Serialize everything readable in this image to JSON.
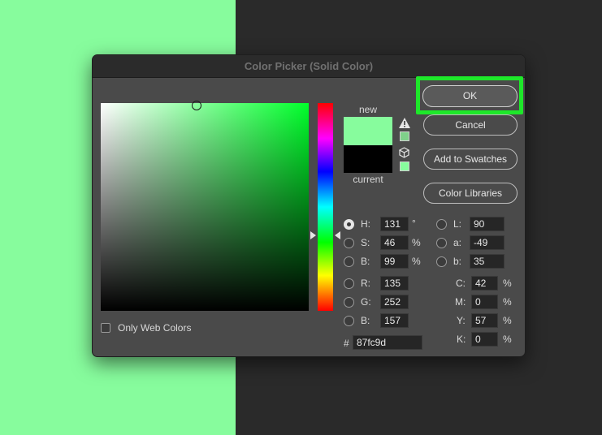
{
  "dialog": {
    "title": "Color Picker (Solid Color)"
  },
  "colors": {
    "selected": "#87fc9d",
    "current": "#000000",
    "hue_pure": "#00ff2b",
    "ok_highlight": "#1ee82a"
  },
  "swatches": {
    "new_label": "new",
    "current_label": "current"
  },
  "icons": {
    "gamut_warning": "warning-triangle-icon",
    "web_safe": "cube-icon"
  },
  "buttons": {
    "ok": "OK",
    "cancel": "Cancel",
    "add_to_swatches": "Add to Swatches",
    "color_libraries": "Color Libraries"
  },
  "hsb": {
    "h": {
      "label": "H:",
      "value": "131",
      "unit": "°",
      "selected": true
    },
    "s": {
      "label": "S:",
      "value": "46",
      "unit": "%"
    },
    "b": {
      "label": "B:",
      "value": "99",
      "unit": "%"
    }
  },
  "rgb": {
    "r": {
      "label": "R:",
      "value": "135"
    },
    "g": {
      "label": "G:",
      "value": "252"
    },
    "b": {
      "label": "B:",
      "value": "157"
    }
  },
  "lab": {
    "l": {
      "label": "L:",
      "value": "90"
    },
    "a": {
      "label": "a:",
      "value": "-49"
    },
    "b": {
      "label": "b:",
      "value": "35"
    }
  },
  "cmyk": {
    "c": {
      "label": "C:",
      "value": "42",
      "unit": "%"
    },
    "m": {
      "label": "M:",
      "value": "0",
      "unit": "%"
    },
    "y": {
      "label": "Y:",
      "value": "57",
      "unit": "%"
    },
    "k": {
      "label": "K:",
      "value": "0",
      "unit": "%"
    }
  },
  "hex": {
    "label": "#",
    "value": "87fc9d"
  },
  "options": {
    "only_web_colors": "Only Web Colors",
    "only_web_colors_checked": false
  },
  "picker": {
    "saturation": 0.46,
    "brightness": 0.99,
    "hue_degrees": 131
  }
}
